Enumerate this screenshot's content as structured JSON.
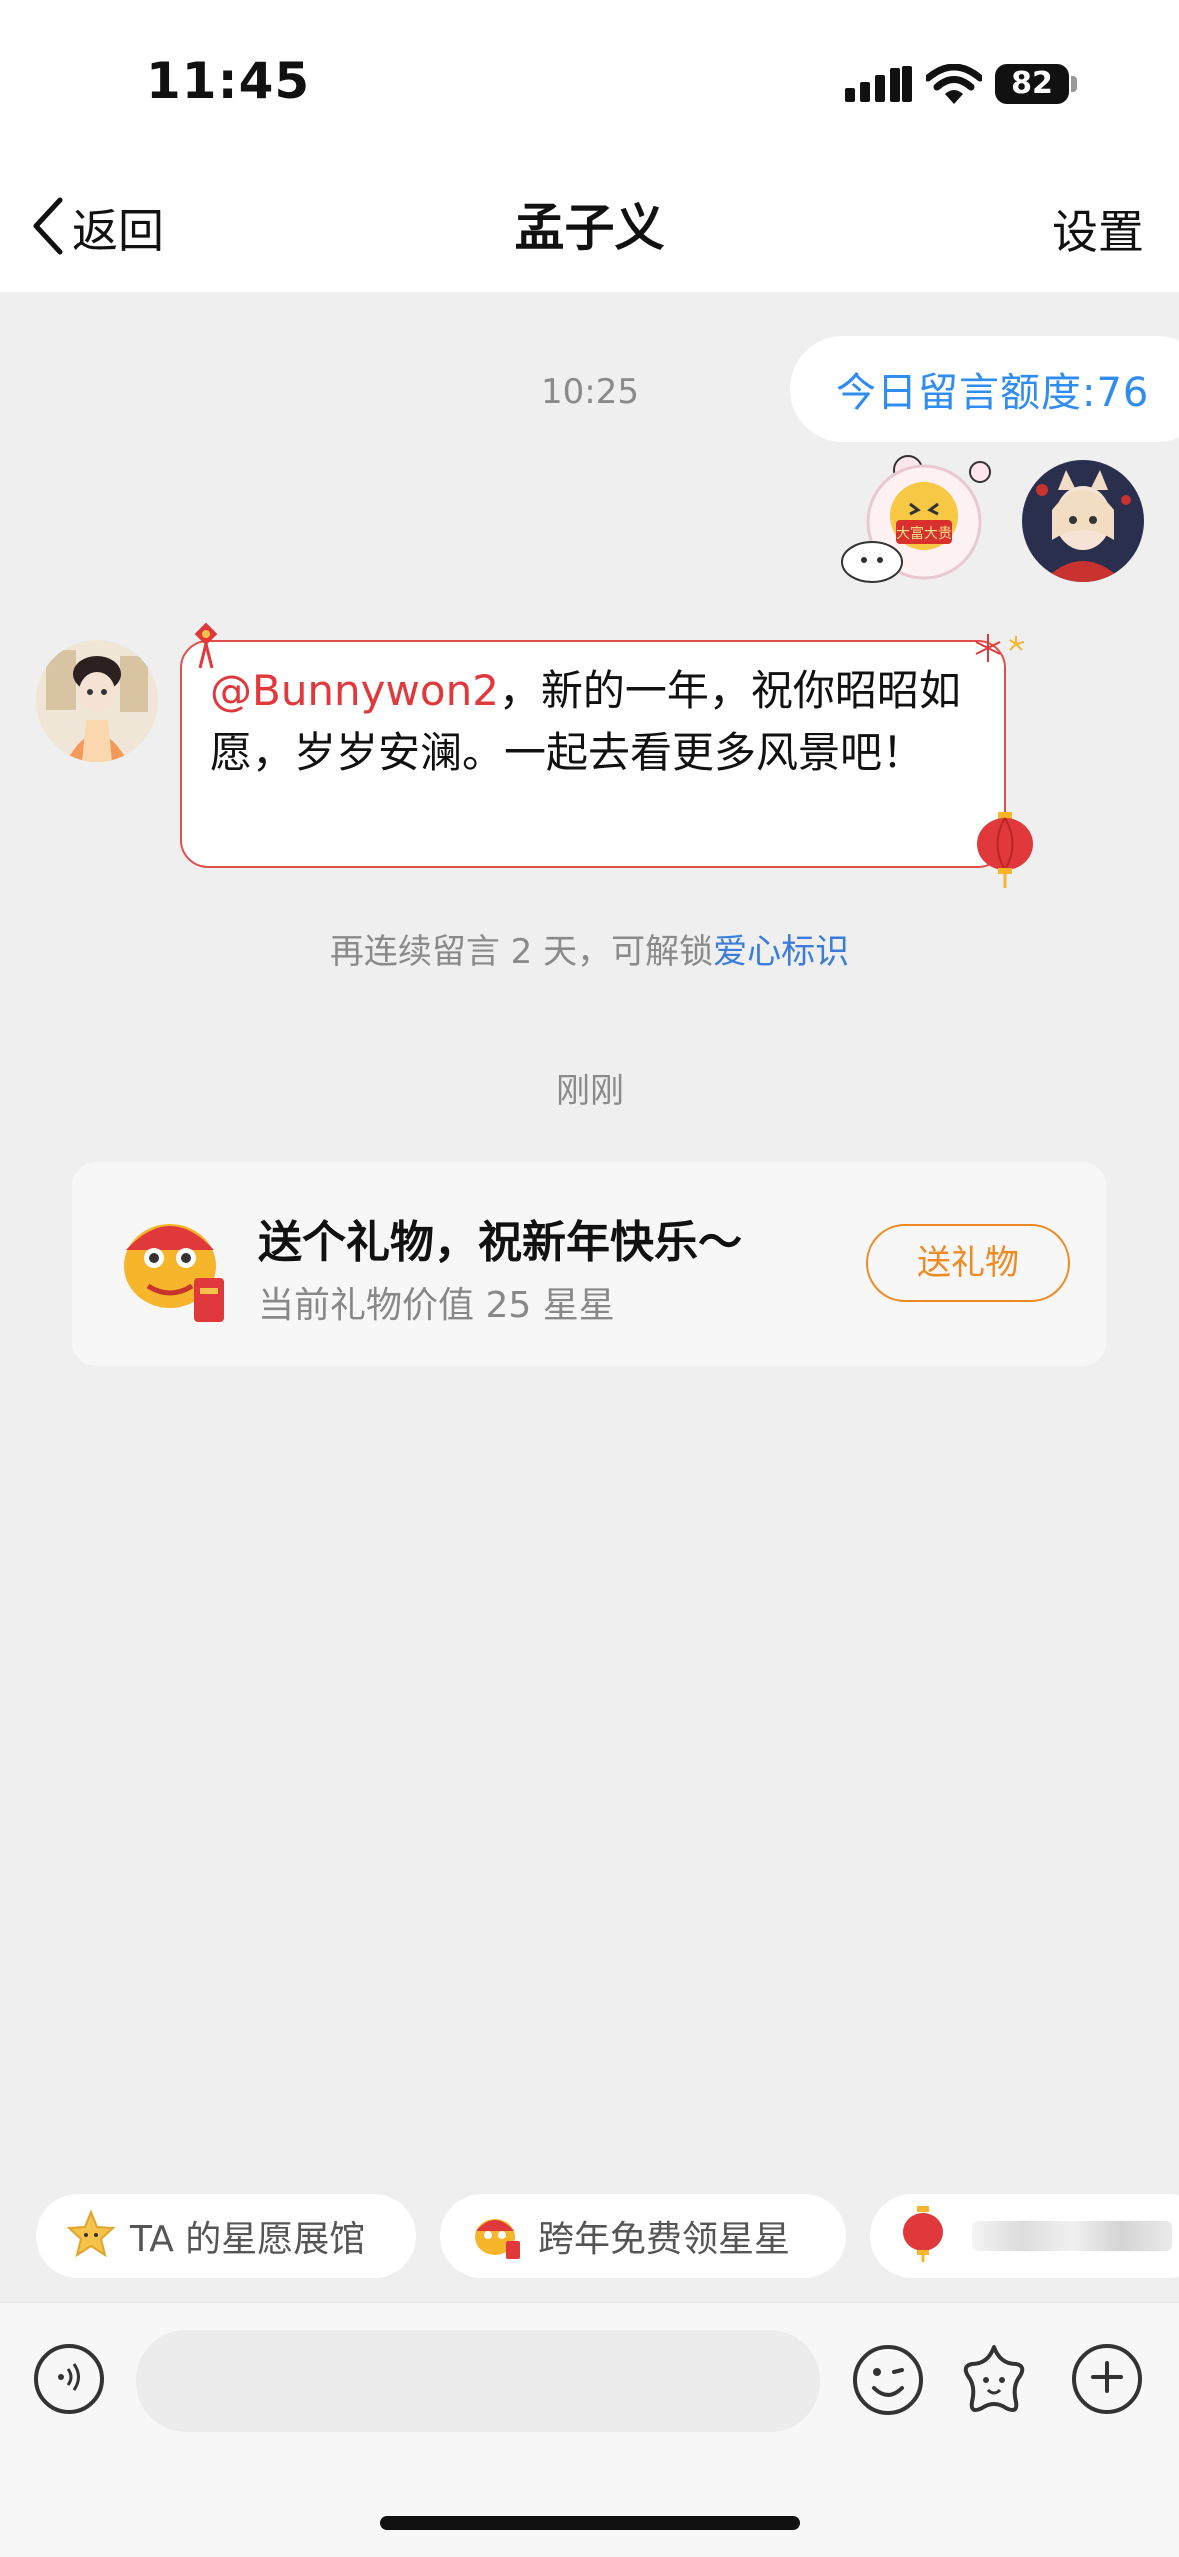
{
  "status_bar": {
    "time": "11:45",
    "battery": "82"
  },
  "nav": {
    "back_label": "返回",
    "title": "孟子义",
    "settings_label": "设置"
  },
  "chat": {
    "quota": "今日留言额度:76",
    "timestamp_1": "10:25",
    "sticker_text": "大富大贵",
    "message_mention": "@Bunnywon2",
    "message_body": "，新的一年，祝你昭昭如愿，岁岁安澜。一起去看更多风景吧！",
    "unlock_prefix": "再连续留言 2 天，可解锁",
    "unlock_link": "爱心标识",
    "timestamp_2": "刚刚"
  },
  "gift_card": {
    "title": "送个礼物，祝新年快乐～",
    "subtitle": "当前礼物价值 25 星星",
    "button_label": "送礼物"
  },
  "quick_chips": [
    {
      "label": "TA 的星愿展馆",
      "icon": "star-icon"
    },
    {
      "label": "跨年免费领星星",
      "icon": "lion-dance-icon"
    },
    {
      "label": "",
      "icon": "lantern-icon"
    }
  ],
  "input_bar": {
    "placeholder": ""
  },
  "colors": {
    "accent_blue": "#2f8cf0",
    "mention_red": "#e0383b",
    "gift_orange": "#f08a23",
    "bubble_border": "#e0504a"
  }
}
